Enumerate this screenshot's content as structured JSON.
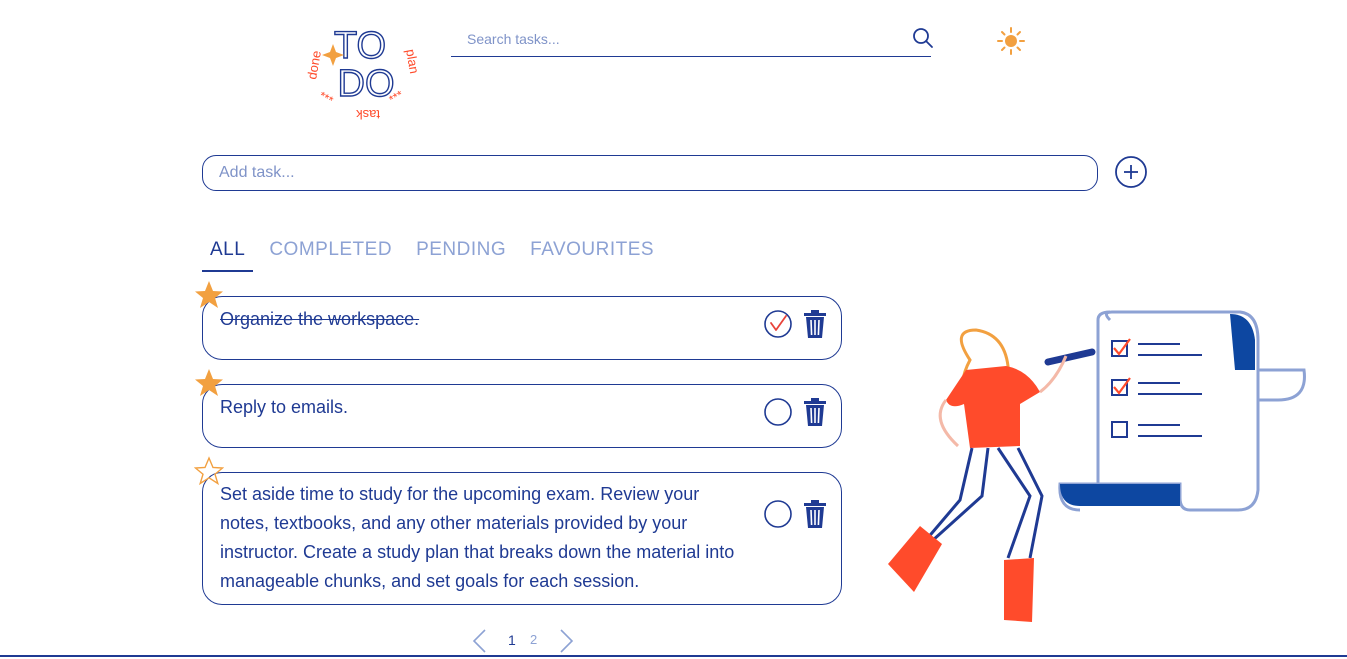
{
  "logo": {
    "line1": "TO",
    "line2": "DO",
    "word_left": "done",
    "word_right": "plan",
    "word_bottom": "task",
    "stars": "***"
  },
  "search": {
    "placeholder": "Search tasks...",
    "value": "",
    "icon": "search-icon"
  },
  "theme_toggle": {
    "icon": "sun-icon"
  },
  "add_task": {
    "placeholder": "Add task...",
    "value": "",
    "icon": "plus-circle-icon"
  },
  "tabs": [
    {
      "label": "ALL",
      "active": true
    },
    {
      "label": "COMPLETED",
      "active": false
    },
    {
      "label": "PENDING",
      "active": false
    },
    {
      "label": "FAVOURITES",
      "active": false
    }
  ],
  "tasks": [
    {
      "text": "Organize the workspace.",
      "completed": true,
      "favourite": true
    },
    {
      "text": "Reply to emails.",
      "completed": false,
      "favourite": true
    },
    {
      "text": "Set aside time to study for the upcoming exam. Review your notes, textbooks, and any other materials provided by your instructor. Create a study plan that breaks down the material into manageable chunks, and set goals for each session.",
      "completed": false,
      "favourite": false
    }
  ],
  "pagination": {
    "pages": [
      "1",
      "2"
    ],
    "current": "1"
  },
  "colors": {
    "primary": "#1f3a93",
    "muted": "#8da2d4",
    "accent_orange": "#f2a040",
    "accent_red": "#ff4b2b",
    "check_red": "#e8433a"
  }
}
